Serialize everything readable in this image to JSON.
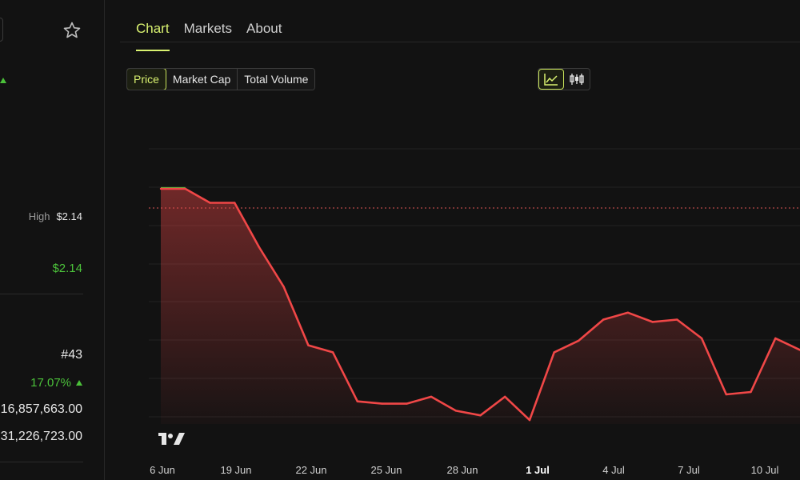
{
  "sidebar": {
    "high_label": "High",
    "high_value": "$2.14",
    "price_value": "$2.14",
    "rank": "#43",
    "change_pct": "17.07%",
    "value_1": "16,857,663.00",
    "value_2": "31,226,723.00"
  },
  "tabs": [
    {
      "label": "Chart",
      "active": true
    },
    {
      "label": "Markets",
      "active": false
    },
    {
      "label": "About",
      "active": false
    }
  ],
  "metric_buttons": [
    {
      "label": "Price",
      "active": true
    },
    {
      "label": "Market Cap",
      "active": false
    },
    {
      "label": "Total Volume",
      "active": false
    }
  ],
  "chart_type_buttons": [
    {
      "icon": "line-chart-icon",
      "active": true
    },
    {
      "icon": "candlestick-icon",
      "active": false
    }
  ],
  "colors": {
    "accent": "#d9f270",
    "up": "#4bc13a",
    "down": "#f04747",
    "background": "#121212"
  },
  "chart_data": {
    "type": "area",
    "x_ticks": [
      "6 Jun",
      "19 Jun",
      "22 Jun",
      "25 Jun",
      "28 Jun",
      "1 Jul",
      "4 Jul",
      "7 Jul",
      "10 Jul"
    ],
    "bold_tick": "1 Jul",
    "grid": true,
    "reference_line": "dashed, red",
    "watermark": "TradingView logo",
    "series": [
      {
        "x": [
          "16 Jun",
          "17 Jun",
          "18 Jun",
          "19 Jun",
          "20 Jun",
          "21 Jun",
          "22 Jun",
          "23 Jun",
          "24 Jun",
          "25 Jun",
          "26 Jun",
          "27 Jun",
          "28 Jun",
          "29 Jun",
          "30 Jun",
          "1 Jul",
          "2 Jul",
          "3 Jul",
          "4 Jul",
          "5 Jul",
          "6 Jul",
          "7 Jul",
          "8 Jul",
          "9 Jul",
          "10 Jul",
          "11 Jul",
          "12 Jul"
        ],
        "values": [
          100,
          100,
          94,
          94,
          75,
          58,
          33,
          30,
          9,
          8,
          8,
          11,
          5,
          3,
          11,
          1,
          30,
          35,
          44,
          47,
          43,
          44,
          36,
          12,
          13,
          36,
          31
        ]
      }
    ]
  }
}
